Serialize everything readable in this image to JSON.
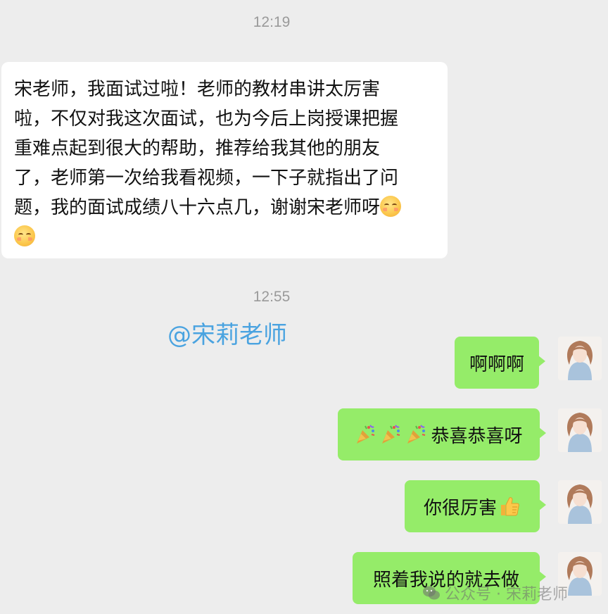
{
  "timestamps": [
    "12:19",
    "12:55"
  ],
  "incoming": {
    "lines": [
      "宋老师，我面试过啦！老师的教材串讲太厉害",
      "啦，不仅对我这次面试，也为今后上岗授课把握",
      "重难点起到很大的帮助，推荐给我其他的朋友",
      "了，老师第一次给我看视频，一下子就指出了问",
      "题，我的面试成绩八十六点几，谢谢宋老师呀"
    ],
    "emoji": "relieved-face"
  },
  "mention": "@宋莉老师",
  "outgoing": [
    {
      "text": "啊啊啊"
    },
    {
      "text": "恭喜恭喜呀",
      "prefix_emoji": "party-popper",
      "prefix_count": 3
    },
    {
      "text": "你很厉害",
      "suffix_emoji": "thumbs-up"
    },
    {
      "text": "照着我说的就去做"
    }
  ],
  "watermark": "公众号 · 宋莉老师",
  "colors": {
    "background": "#ededed",
    "outgoing_bubble": "#95ec69",
    "incoming_bubble": "#ffffff",
    "mention": "#4aa3e0"
  }
}
